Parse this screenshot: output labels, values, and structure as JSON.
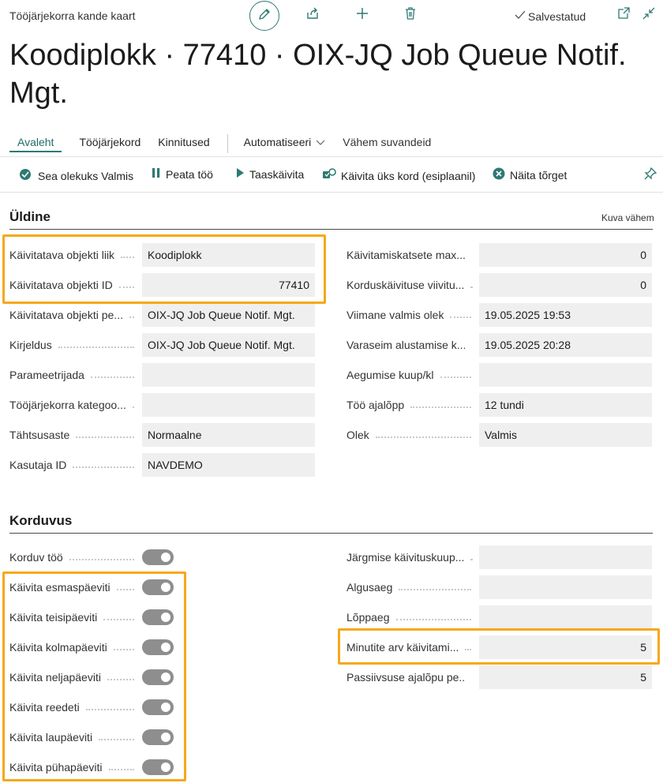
{
  "breadcrumb": "Tööjärjekorra kande kaart",
  "saved_label": "Salvestatud",
  "title": "Koodiplokk · 77410 · OIX-JQ Job Queue Notif. Mgt.",
  "tabs": {
    "home": "Avaleht",
    "job_queue": "Tööjärjekord",
    "pinned": "Kinnitused",
    "automate": "Automatiseeri",
    "fewer_options": "Vähem suvandeid"
  },
  "actions": {
    "set_ready": "Sea olekuks Valmis",
    "hold": "Peata töö",
    "restart": "Taaskäivita",
    "run_once": "Käivita üks kord (esiplaanil)",
    "show_error": "Näita tõrget"
  },
  "general": {
    "title": "Üldine",
    "show_less": "Kuva vähem",
    "left": [
      {
        "label": "Käivitatava objekti liik",
        "value": "Koodiplokk",
        "align": "left"
      },
      {
        "label": "Käivitatava objekti ID",
        "value": "77410",
        "align": "right"
      },
      {
        "label": "Käivitatava objekti pe...",
        "value": "OIX-JQ Job Queue Notif. Mgt.",
        "align": "left"
      },
      {
        "label": "Kirjeldus",
        "value": "OIX-JQ Job Queue Notif. Mgt.",
        "align": "left"
      },
      {
        "label": "Parameetrijada",
        "value": "",
        "align": "left"
      },
      {
        "label": "Tööjärjekorra kategoo...",
        "value": "",
        "align": "left"
      },
      {
        "label": "Tähtsusaste",
        "value": "Normaalne",
        "align": "left"
      },
      {
        "label": "Kasutaja ID",
        "value": "NAVDEMO",
        "align": "left"
      }
    ],
    "right": [
      {
        "label": "Käivitamiskatsete max...",
        "value": "0",
        "align": "right"
      },
      {
        "label": "Korduskäivituse viivitu...",
        "value": "0",
        "align": "right"
      },
      {
        "label": "Viimane valmis olek",
        "value": "19.05.2025 19:53",
        "align": "left"
      },
      {
        "label": "Varaseim alustamise k...",
        "value": "19.05.2025 20:28",
        "align": "left"
      },
      {
        "label": "Aegumise kuup/kl",
        "value": "",
        "align": "left"
      },
      {
        "label": "Töö ajalõpp",
        "value": "12 tundi",
        "align": "left"
      },
      {
        "label": "Olek",
        "value": "Valmis",
        "align": "left"
      }
    ]
  },
  "recurrence": {
    "title": "Korduvus",
    "left": [
      {
        "label": "Korduv töö",
        "on": true
      },
      {
        "label": "Käivita esmaspäeviti",
        "on": true
      },
      {
        "label": "Käivita teisipäeviti",
        "on": true
      },
      {
        "label": "Käivita kolmapäeviti",
        "on": true
      },
      {
        "label": "Käivita neljapäeviti",
        "on": true
      },
      {
        "label": "Käivita reedeti",
        "on": true
      },
      {
        "label": "Käivita laupäeviti",
        "on": true
      },
      {
        "label": "Käivita pühapäeviti",
        "on": true
      }
    ],
    "right": [
      {
        "label": "Järgmise käivituskuup...",
        "value": "",
        "align": "left"
      },
      {
        "label": "Algusaeg",
        "value": "",
        "align": "left"
      },
      {
        "label": "Lõppaeg",
        "value": "",
        "align": "left"
      },
      {
        "label": "Minutite arv käivitami...",
        "value": "5",
        "align": "right"
      },
      {
        "label": "Passiivsuse ajalõpu pe...",
        "value": "5",
        "align": "right"
      }
    ]
  },
  "colors": {
    "accent": "#2e7a73",
    "highlight": "#f6a81b",
    "field_bg": "#efefef",
    "toggle_on": "#8e8e8e"
  }
}
